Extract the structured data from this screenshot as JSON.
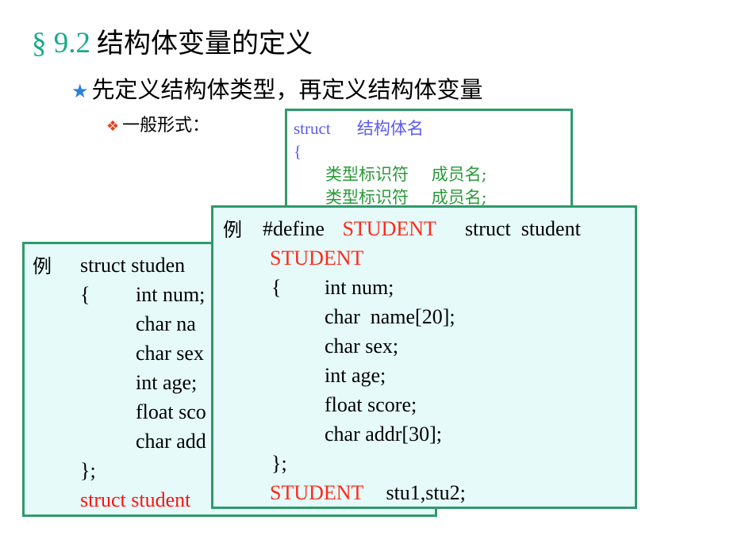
{
  "title": {
    "section": "§ 9.2",
    "text": "结构体变量的定义"
  },
  "bullet1": {
    "icon": "star-icon",
    "text": "先定义结构体类型，再定义结构体变量"
  },
  "bullet2": {
    "icon": "diamond-cluster-icon",
    "text": "一般形式："
  },
  "general_form": {
    "line1_keyword": "struct",
    "line1_name": "结构体名",
    "line2": "{",
    "members": [
      {
        "type": "类型标识符",
        "name": "成员名;"
      },
      {
        "type": "类型标识符",
        "name": "成员名;"
      }
    ]
  },
  "example_back": {
    "label": "例",
    "lines": [
      "struct   studen",
      "{",
      "int num;",
      "char  na",
      "char sex",
      "int age;",
      "float sco",
      "char add",
      "};",
      "struct student"
    ]
  },
  "example_front": {
    "label": "例",
    "define_kw": "#define",
    "define_name": "STUDENT",
    "define_value": "struct  student",
    "type_name": "STUDENT",
    "open_brace": "{",
    "members": [
      "int num;",
      "char  name[20];",
      "char sex;",
      "int age;",
      "float score;",
      "char addr[30];"
    ],
    "close_brace": "};",
    "decl_type": "STUDENT",
    "decl_vars": "stu1,stu2;"
  },
  "colors": {
    "section": "#1aa98a",
    "star": "#2a7fe0",
    "diamond": "#e8401c",
    "box_border": "#2e9a6a",
    "box_fill": "#e6fafa",
    "highlight": "#ff2a1a",
    "form_keyword": "#5b5bef",
    "form_member": "#2a9a3a"
  }
}
